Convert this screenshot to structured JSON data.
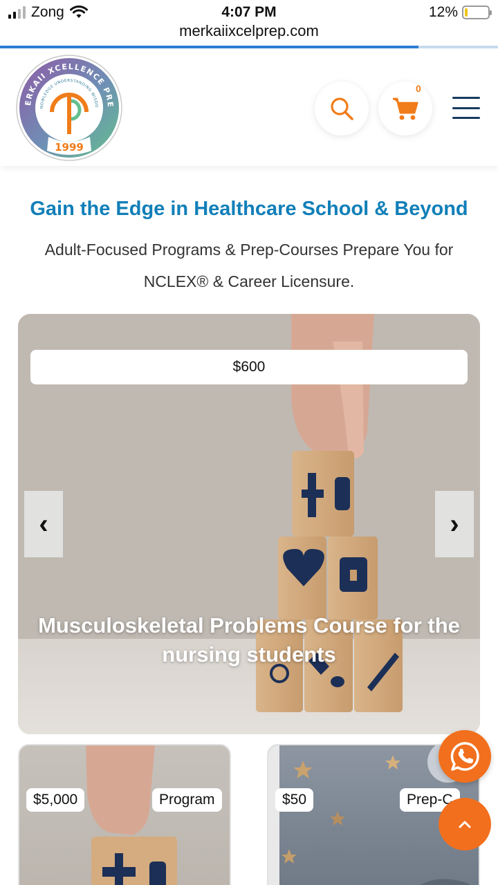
{
  "status_bar": {
    "carrier": "Zong",
    "time": "4:07 PM",
    "battery_text": "12%",
    "battery_level": 0.12,
    "signal_bars_active": 2,
    "signal_bars_total": 4
  },
  "browser": {
    "url": "merkaiixcelprep.com",
    "load_progress": 0.84,
    "accent_color": "#2d7fd3"
  },
  "header": {
    "logo": {
      "arc_text": "MERKAII XCELLENCE PREP",
      "inner_text": "KNOWLEDGE UNDERSTANDING WISDOM",
      "year": "1999"
    },
    "search_icon": "search-icon",
    "cart_icon": "shopping-cart-icon",
    "cart_count": "0",
    "menu_icon": "hamburger-menu-icon",
    "brand_orange": "#f07c1a",
    "brand_navy": "#163a5e"
  },
  "hero": {
    "headline": "Gain the Edge in Healthcare School & Beyond",
    "subheadline": "Adult-Focused Programs & Prep-Courses Prepare You for NCLEX® & Career Licensure.",
    "headline_color": "#117fb8"
  },
  "featured": {
    "price": "$600",
    "prev_label": "‹",
    "next_label": "›",
    "title": "Musculoskeletal Problems Course for the nursing students"
  },
  "cards": [
    {
      "price": "$5,000",
      "category": "Program"
    },
    {
      "price": "$50",
      "category": "Prep-C"
    }
  ],
  "floating": {
    "whatsapp_icon": "whatsapp-icon",
    "scroll_top_icon": "chevron-up-icon",
    "button_color": "#f26f1d"
  }
}
